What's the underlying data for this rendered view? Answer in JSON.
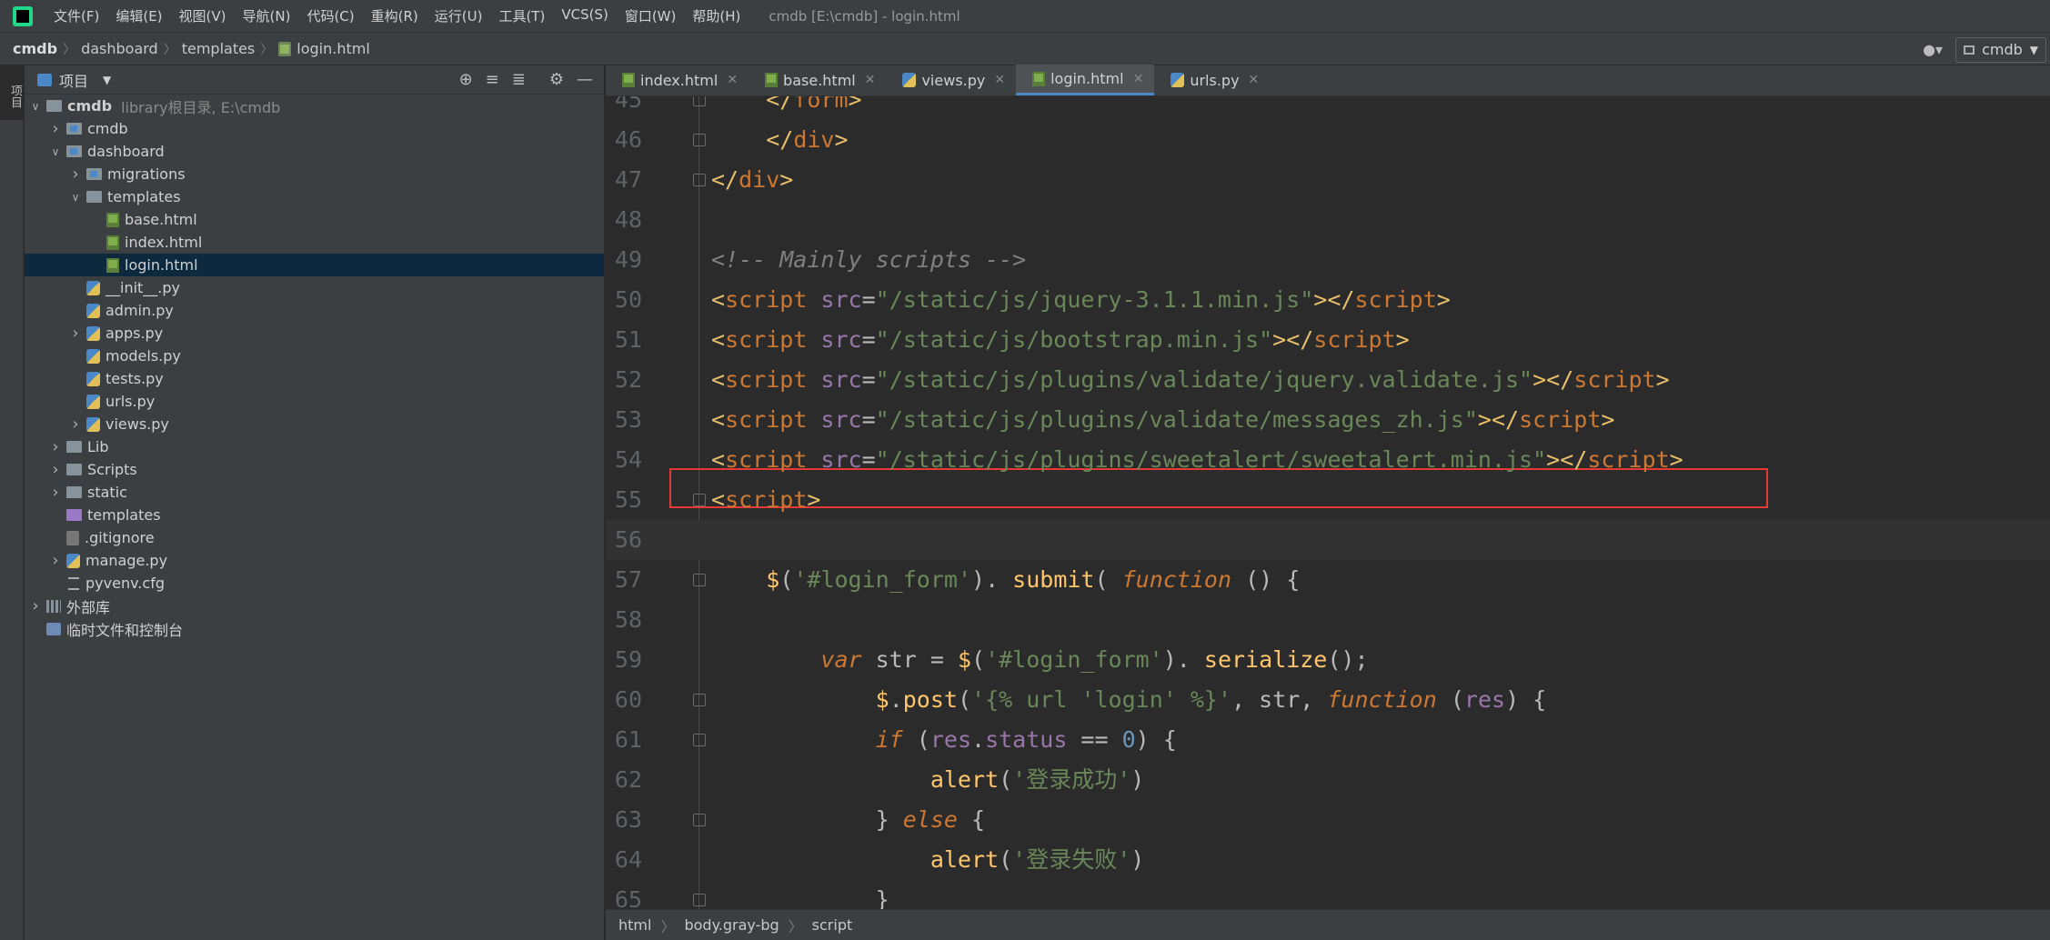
{
  "menubar": {
    "items": [
      "文件(F)",
      "编辑(E)",
      "视图(V)",
      "导航(N)",
      "代码(C)",
      "重构(R)",
      "运行(U)",
      "工具(T)",
      "VCS(S)",
      "窗口(W)",
      "帮助(H)"
    ],
    "window_title": "cmdb [E:\\cmdb] - login.html"
  },
  "breadcrumb": [
    "cmdb",
    "dashboard",
    "templates",
    "login.html"
  ],
  "toolbar": {
    "run_config": "cmdb"
  },
  "left_strip": {
    "project_label": "项目"
  },
  "project_panel": {
    "title": "项目",
    "tree": [
      {
        "label": "cmdb",
        "hint": "library根目录, E:\\cmdb",
        "depth": 0,
        "expanded": true,
        "kind": "folder"
      },
      {
        "label": "cmdb",
        "depth": 1,
        "expanded": false,
        "kind": "module"
      },
      {
        "label": "dashboard",
        "depth": 1,
        "expanded": true,
        "kind": "module"
      },
      {
        "label": "migrations",
        "depth": 2,
        "expanded": false,
        "kind": "module"
      },
      {
        "label": "templates",
        "depth": 2,
        "expanded": true,
        "kind": "folder"
      },
      {
        "label": "base.html",
        "depth": 3,
        "kind": "html"
      },
      {
        "label": "index.html",
        "depth": 3,
        "kind": "html"
      },
      {
        "label": "login.html",
        "depth": 3,
        "kind": "html",
        "selected": true
      },
      {
        "label": "__init__.py",
        "depth": 2,
        "kind": "py"
      },
      {
        "label": "admin.py",
        "depth": 2,
        "kind": "py"
      },
      {
        "label": "apps.py",
        "depth": 2,
        "expanded": false,
        "kind": "py"
      },
      {
        "label": "models.py",
        "depth": 2,
        "kind": "py"
      },
      {
        "label": "tests.py",
        "depth": 2,
        "kind": "py"
      },
      {
        "label": "urls.py",
        "depth": 2,
        "kind": "py"
      },
      {
        "label": "views.py",
        "depth": 2,
        "expanded": false,
        "kind": "py"
      },
      {
        "label": "Lib",
        "depth": 1,
        "expanded": false,
        "kind": "folder"
      },
      {
        "label": "Scripts",
        "depth": 1,
        "expanded": false,
        "kind": "folder"
      },
      {
        "label": "static",
        "depth": 1,
        "expanded": false,
        "kind": "folder"
      },
      {
        "label": "templates",
        "depth": 1,
        "kind": "template-folder"
      },
      {
        "label": ".gitignore",
        "depth": 1,
        "kind": "git"
      },
      {
        "label": "manage.py",
        "depth": 1,
        "expanded": false,
        "kind": "py"
      },
      {
        "label": "pyvenv.cfg",
        "depth": 1,
        "kind": "cfg"
      },
      {
        "label": "外部库",
        "depth": 0,
        "expanded": false,
        "kind": "lib"
      },
      {
        "label": "临时文件和控制台",
        "depth": 0,
        "kind": "scratch"
      }
    ]
  },
  "editor": {
    "tabs": [
      {
        "label": "index.html",
        "kind": "html",
        "active": false
      },
      {
        "label": "base.html",
        "kind": "html",
        "active": false
      },
      {
        "label": "views.py",
        "kind": "py",
        "active": false
      },
      {
        "label": "login.html",
        "kind": "html",
        "active": true
      },
      {
        "label": "urls.py",
        "kind": "py",
        "active": false
      }
    ],
    "lines": [
      {
        "n": "45",
        "segs": [
          [
            "    ",
            ""
          ],
          [
            "</",
            "tg"
          ],
          [
            "form",
            "tgn"
          ],
          [
            ">",
            "tg"
          ]
        ],
        "fold": true
      },
      {
        "n": "46",
        "segs": [
          [
            "    ",
            ""
          ],
          [
            "</",
            "tg"
          ],
          [
            "div",
            "tgn"
          ],
          [
            ">",
            "tg"
          ]
        ],
        "fold": true
      },
      {
        "n": "47",
        "segs": [
          [
            "</",
            "tg"
          ],
          [
            "div",
            "tgn"
          ],
          [
            ">",
            "tg"
          ]
        ],
        "fold": true
      },
      {
        "n": "48",
        "segs": []
      },
      {
        "n": "49",
        "segs": [
          [
            "<!-- Mainly scripts -->",
            "cm"
          ]
        ]
      },
      {
        "n": "50",
        "segs": [
          [
            "<",
            "tg"
          ],
          [
            "script ",
            "tgn"
          ],
          [
            "src",
            "vr"
          ],
          [
            "=",
            "at"
          ],
          [
            "\"/static/js/jquery-3.1.1.min.js\"",
            "st"
          ],
          [
            "></",
            "tg"
          ],
          [
            "script",
            "tgn"
          ],
          [
            ">",
            "tg"
          ]
        ]
      },
      {
        "n": "51",
        "segs": [
          [
            "<",
            "tg"
          ],
          [
            "script ",
            "tgn"
          ],
          [
            "src",
            "vr"
          ],
          [
            "=",
            "at"
          ],
          [
            "\"/static/js/bootstrap.min.js\"",
            "st"
          ],
          [
            "></",
            "tg"
          ],
          [
            "script",
            "tgn"
          ],
          [
            ">",
            "tg"
          ]
        ]
      },
      {
        "n": "52",
        "segs": [
          [
            "<",
            "tg"
          ],
          [
            "script ",
            "tgn"
          ],
          [
            "src",
            "vr"
          ],
          [
            "=",
            "at"
          ],
          [
            "\"/static/js/plugins/validate/jquery.validate.js\"",
            "st"
          ],
          [
            "></",
            "tg"
          ],
          [
            "script",
            "tgn"
          ],
          [
            ">",
            "tg"
          ]
        ]
      },
      {
        "n": "53",
        "segs": [
          [
            "<",
            "tg"
          ],
          [
            "script ",
            "tgn"
          ],
          [
            "src",
            "vr"
          ],
          [
            "=",
            "at"
          ],
          [
            "\"/static/js/plugins/validate/messages_zh.js\"",
            "st"
          ],
          [
            "></",
            "tg"
          ],
          [
            "script",
            "tgn"
          ],
          [
            ">",
            "tg"
          ]
        ]
      },
      {
        "n": "54",
        "segs": [
          [
            "<",
            "tg"
          ],
          [
            "script ",
            "tgn"
          ],
          [
            "src",
            "vr"
          ],
          [
            "=",
            "at"
          ],
          [
            "\"/static/js/plugins/sweetalert/sweetalert.min.js\"",
            "st"
          ],
          [
            "></",
            "tg"
          ],
          [
            "script",
            "tgn"
          ],
          [
            ">",
            "tg"
          ]
        ],
        "boxed": true
      },
      {
        "n": "55",
        "segs": [
          [
            "<",
            "tg"
          ],
          [
            "script",
            "tgn"
          ],
          [
            ">",
            "tg"
          ]
        ],
        "fold": true
      },
      {
        "n": "56",
        "segs": [],
        "current": true
      },
      {
        "n": "57",
        "segs": [
          [
            "    ",
            ""
          ],
          [
            "$",
            "fn"
          ],
          [
            "(",
            "at"
          ],
          [
            "'#login_form'",
            "st"
          ],
          [
            "). ",
            "at"
          ],
          [
            "submit",
            "fn"
          ],
          [
            "( ",
            "at"
          ],
          [
            "function",
            "kw"
          ],
          [
            " () {",
            "at"
          ]
        ],
        "fold": true
      },
      {
        "n": "58",
        "segs": []
      },
      {
        "n": "59",
        "segs": [
          [
            "        ",
            ""
          ],
          [
            "var",
            "kw"
          ],
          [
            " str = ",
            "at"
          ],
          [
            "$",
            "fn"
          ],
          [
            "(",
            "at"
          ],
          [
            "'#login_form'",
            "st"
          ],
          [
            "). ",
            "at"
          ],
          [
            "serialize",
            "fn"
          ],
          [
            "();",
            "at"
          ]
        ]
      },
      {
        "n": "60",
        "segs": [
          [
            "            ",
            ""
          ],
          [
            "$",
            "fn"
          ],
          [
            ".",
            "at"
          ],
          [
            "post",
            "fn"
          ],
          [
            "(",
            "at"
          ],
          [
            "'{% url 'login' %}'",
            "st"
          ],
          [
            ", str, ",
            "at"
          ],
          [
            "function",
            "kw"
          ],
          [
            " (",
            "at"
          ],
          [
            "res",
            "vr"
          ],
          [
            ") {",
            "at"
          ]
        ],
        "fold": true
      },
      {
        "n": "61",
        "segs": [
          [
            "            ",
            ""
          ],
          [
            "if",
            "kw"
          ],
          [
            " (",
            "at"
          ],
          [
            "res",
            "vr"
          ],
          [
            ".",
            "at"
          ],
          [
            "status",
            "vr"
          ],
          [
            " == ",
            "at"
          ],
          [
            "0",
            "nm"
          ],
          [
            ") {",
            "at"
          ]
        ],
        "fold": true
      },
      {
        "n": "62",
        "segs": [
          [
            "                ",
            ""
          ],
          [
            "alert",
            "fn"
          ],
          [
            "(",
            "at"
          ],
          [
            "'登录成功'",
            "st"
          ],
          [
            ")",
            "at"
          ]
        ]
      },
      {
        "n": "63",
        "segs": [
          [
            "            ",
            ""
          ],
          [
            "} ",
            "at"
          ],
          [
            "else",
            "kw"
          ],
          [
            " {",
            "at"
          ]
        ],
        "fold": true
      },
      {
        "n": "64",
        "segs": [
          [
            "                ",
            ""
          ],
          [
            "alert",
            "fn"
          ],
          [
            "(",
            "at"
          ],
          [
            "'登录失败'",
            "st"
          ],
          [
            ")",
            "at"
          ]
        ]
      },
      {
        "n": "65",
        "segs": [
          [
            "            ",
            ""
          ],
          [
            "}",
            "at"
          ]
        ],
        "fold": true
      }
    ]
  },
  "status_breadcrumb": [
    "html",
    "body.gray-bg",
    "script"
  ]
}
